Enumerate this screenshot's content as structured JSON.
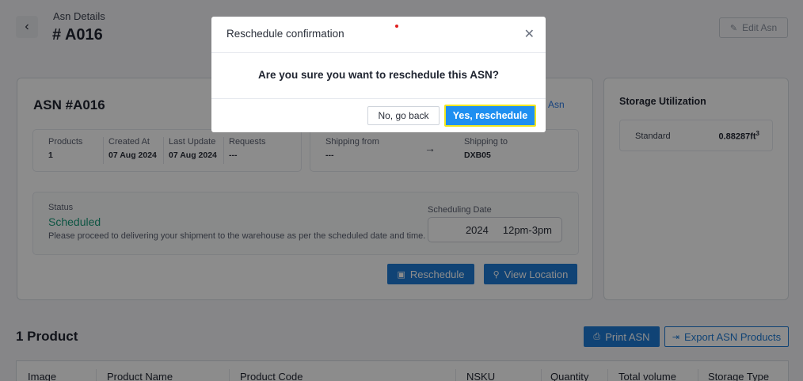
{
  "header": {
    "back_icon": "chevron-left-icon",
    "subtitle": "Asn Details",
    "title": "# A016",
    "edit_label": "Edit Asn"
  },
  "asn": {
    "title": "ASN #A016",
    "link_label": "Asn",
    "info": {
      "products_label": "Products",
      "products_value": "1",
      "created_label": "Created At",
      "created_value": "07 Aug 2024",
      "updated_label": "Last Update",
      "updated_value": "07 Aug 2024",
      "requests_label": "Requests",
      "requests_value": "---",
      "from_label": "Shipping from",
      "from_value": "---",
      "to_label": "Shipping to",
      "to_value": "DXB05"
    },
    "status_label": "Status",
    "status_value": "Scheduled",
    "status_note": "Please proceed to delivering your shipment to the warehouse as per the scheduled date and time.",
    "scheduling_label": "Scheduling Date",
    "scheduling_year": "2024",
    "scheduling_time": "12pm-3pm",
    "reschedule_label": "Reschedule",
    "view_location_label": "View Location"
  },
  "storage": {
    "title": "Storage Utilization",
    "row_name": "Standard",
    "row_value": "0.88287ft",
    "row_unit_sup": "3"
  },
  "products": {
    "title": "1 Product",
    "print_label": "Print ASN",
    "export_label": "Export ASN Products",
    "columns": [
      "Image",
      "Product Name",
      "Product Code",
      "NSKU",
      "Quantity",
      "Total volume",
      "Storage Type"
    ]
  },
  "modal": {
    "title": "Reschedule confirmation",
    "question": "Are you sure you want to reschedule this ASN?",
    "no_label": "No, go back",
    "yes_label": "Yes, reschedule",
    "close_icon": "close-icon"
  },
  "colors": {
    "primary": "#1e7bd6",
    "status_green": "#1a9c7a",
    "focus_ring": "#f0e620"
  }
}
